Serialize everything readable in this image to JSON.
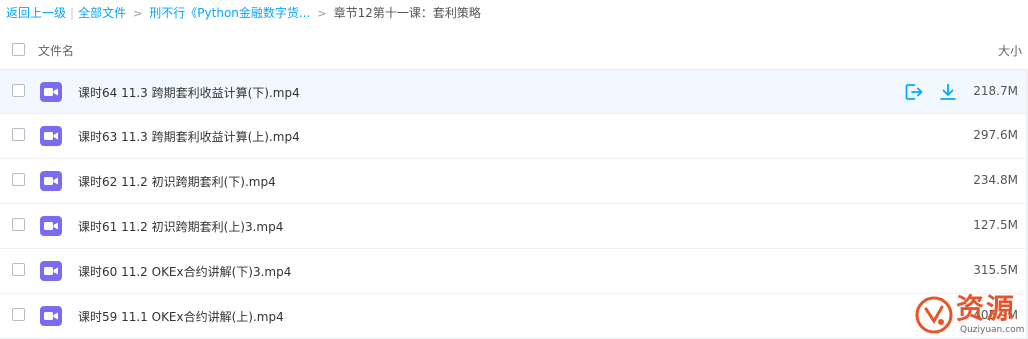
{
  "breadcrumb": {
    "back": "返回上一级",
    "all_files": "全部文件",
    "folder": "刑不行《Python金融数字货...",
    "current": "章节12第十一课：套利策略"
  },
  "header": {
    "name_col": "文件名",
    "size_col": "大小"
  },
  "files": [
    {
      "name": "课时64 11.3 跨期套利收益计算(下).mp4",
      "size": "218.7M"
    },
    {
      "name": "课时63 11.3 跨期套利收益计算(上).mp4",
      "size": "297.6M"
    },
    {
      "name": "课时62 11.2 初识跨期套利(下).mp4",
      "size": "234.8M"
    },
    {
      "name": "课时61 11.2 初识跨期套利(上)3.mp4",
      "size": "127.5M"
    },
    {
      "name": "课时60 11.2 OKEx合约讲解(下)3.mp4",
      "size": "315.5M"
    },
    {
      "name": "课时59 11.1 OKEx合约讲解(上).mp4",
      "size": "405.9M"
    }
  ],
  "icons": {
    "file": "video-file-icon",
    "share": "share-icon",
    "download": "download-icon"
  },
  "colors": {
    "link": "#06a7ff",
    "video_icon": "#7a6cf0",
    "hover_row": "#f2f8ff",
    "watermark": "#e8542a"
  },
  "watermark": {
    "text": "资源",
    "sub": "Quziyuan.com"
  }
}
